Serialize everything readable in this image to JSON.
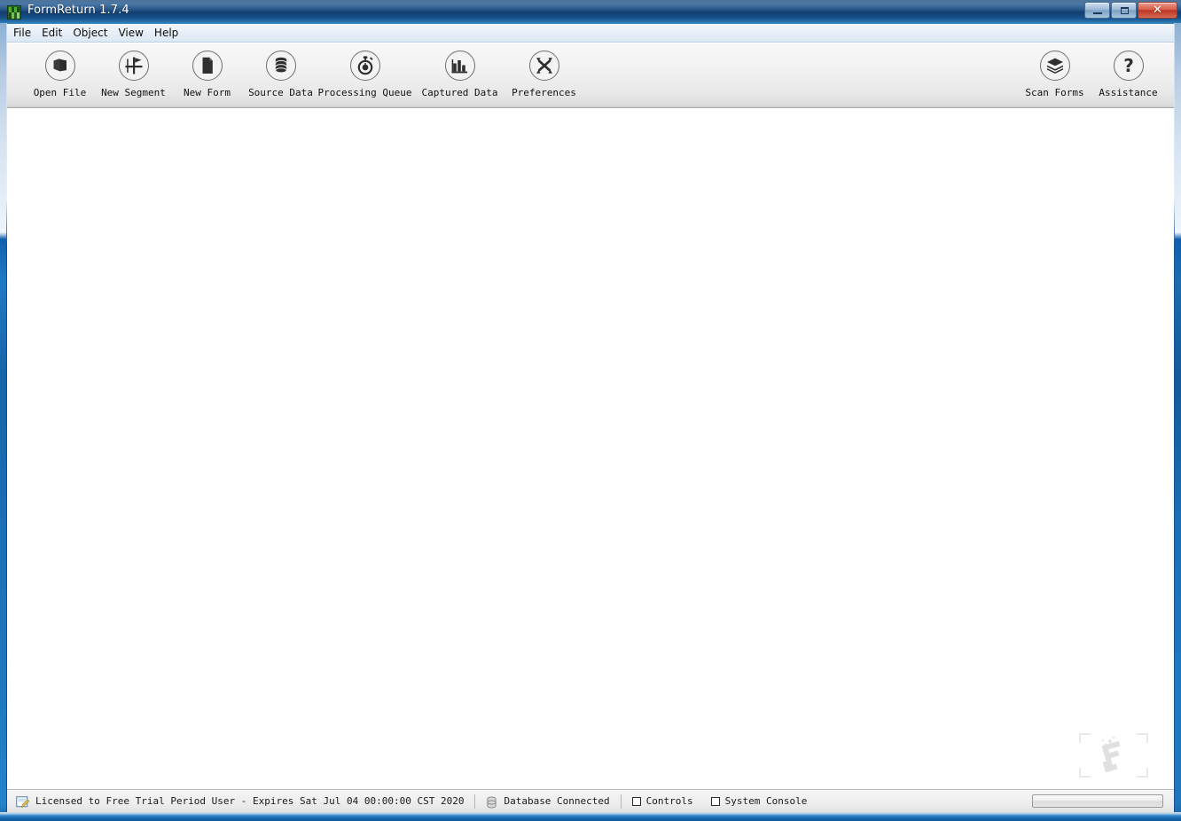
{
  "window": {
    "title": "FormReturn 1.7.4",
    "app_icon": "formreturn-app-icon",
    "controls": {
      "minimize": "–",
      "maximize": "□",
      "close": "✕"
    }
  },
  "menubar": {
    "items": [
      {
        "label": "File"
      },
      {
        "label": "Edit"
      },
      {
        "label": "Object"
      },
      {
        "label": "View"
      },
      {
        "label": "Help"
      }
    ]
  },
  "toolbar": {
    "left_buttons": [
      {
        "label": "Open File",
        "icon": "open-file-icon"
      },
      {
        "label": "New Segment",
        "icon": "new-segment-icon"
      },
      {
        "label": "New Form",
        "icon": "new-form-icon"
      },
      {
        "label": "Source Data",
        "icon": "database-icon"
      },
      {
        "label": "Processing Queue",
        "icon": "stopwatch-icon"
      },
      {
        "label": "Captured Data",
        "icon": "bar-chart-icon"
      },
      {
        "label": "Preferences",
        "icon": "tools-icon"
      }
    ],
    "right_buttons": [
      {
        "label": "Scan Forms",
        "icon": "stacked-layers-icon"
      },
      {
        "label": "Assistance",
        "icon": "question-mark-icon"
      }
    ]
  },
  "canvas": {
    "watermark": "formreturn-watermark-logo"
  },
  "statusbar": {
    "license_text": "Licensed to Free Trial Period User - Expires Sat Jul 04 00:00:00 CST 2020",
    "license_icon": "document-edit-icon",
    "database_text": "Database Connected",
    "database_icon": "database-small-icon",
    "toggles": [
      {
        "label": "Controls",
        "checked": false
      },
      {
        "label": "System Console",
        "checked": false
      }
    ],
    "progress_value": 0
  },
  "colors": {
    "titlebar_dark": "#123d6e",
    "titlebar_light": "#3f8cc4",
    "close_button": "#bb3623",
    "frame_blue": "#1767ab",
    "toolbar_bg": "#f2f2f2",
    "canvas_bg": "#ffffff",
    "status_bg": "#eeeeee"
  }
}
